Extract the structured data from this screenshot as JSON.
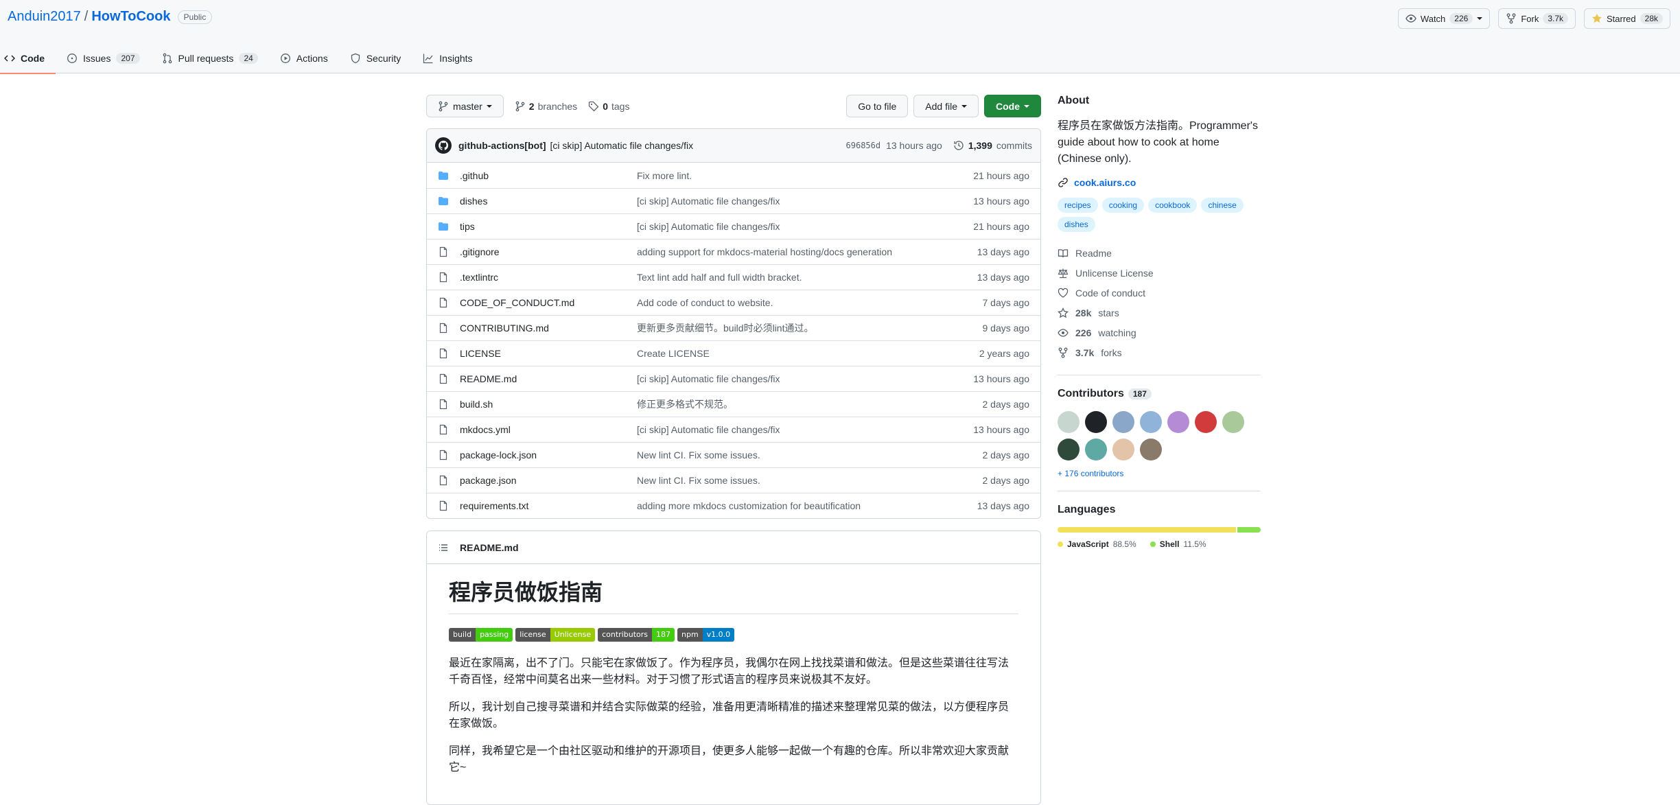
{
  "repo": {
    "owner": "Anduin2017",
    "separator": "/",
    "name": "HowToCook",
    "visibility": "Public"
  },
  "actions": {
    "watch_label": "Watch",
    "watch_count": "226",
    "fork_label": "Fork",
    "fork_count": "3.7k",
    "star_label": "Starred",
    "star_count": "28k"
  },
  "tabs": [
    {
      "label": "Code",
      "count": ""
    },
    {
      "label": "Issues",
      "count": "207"
    },
    {
      "label": "Pull requests",
      "count": "24"
    },
    {
      "label": "Actions",
      "count": ""
    },
    {
      "label": "Security",
      "count": ""
    },
    {
      "label": "Insights",
      "count": ""
    }
  ],
  "toolbar": {
    "branch": "master",
    "branches_count": "2",
    "branches_label": "branches",
    "tags_count": "0",
    "tags_label": "tags",
    "goto_file": "Go to file",
    "add_file": "Add file",
    "code": "Code"
  },
  "latest_commit": {
    "author": "github-actions[bot]",
    "message": "[ci skip] Automatic file changes/fix",
    "sha": "696856d",
    "age": "13 hours ago",
    "commit_count": "1,399",
    "commit_label": "commits"
  },
  "files": [
    {
      "name": ".github",
      "type": "dir",
      "message": "Fix more lint.",
      "age": "21 hours ago"
    },
    {
      "name": "dishes",
      "type": "dir",
      "message": "[ci skip] Automatic file changes/fix",
      "age": "13 hours ago"
    },
    {
      "name": "tips",
      "type": "dir",
      "message": "[ci skip] Automatic file changes/fix",
      "age": "21 hours ago"
    },
    {
      "name": ".gitignore",
      "type": "file",
      "message": "adding support for mkdocs-material hosting/docs generation",
      "age": "13 days ago"
    },
    {
      "name": ".textlintrc",
      "type": "file",
      "message": "Text lint add half and full width bracket.",
      "age": "13 days ago"
    },
    {
      "name": "CODE_OF_CONDUCT.md",
      "type": "file",
      "message": "Add code of conduct to website.",
      "age": "7 days ago"
    },
    {
      "name": "CONTRIBUTING.md",
      "type": "file",
      "message": "更新更多贡献细节。build时必须lint通过。",
      "age": "9 days ago"
    },
    {
      "name": "LICENSE",
      "type": "file",
      "message": "Create LICENSE",
      "age": "2 years ago"
    },
    {
      "name": "README.md",
      "type": "file",
      "message": "[ci skip] Automatic file changes/fix",
      "age": "13 hours ago"
    },
    {
      "name": "build.sh",
      "type": "file",
      "message": "修正更多格式不规范。",
      "age": "2 days ago"
    },
    {
      "name": "mkdocs.yml",
      "type": "file",
      "message": "[ci skip] Automatic file changes/fix",
      "age": "13 hours ago"
    },
    {
      "name": "package-lock.json",
      "type": "file",
      "message": "New lint CI. Fix some issues.",
      "age": "2 days ago"
    },
    {
      "name": "package.json",
      "type": "file",
      "message": "New lint CI. Fix some issues.",
      "age": "2 days ago"
    },
    {
      "name": "requirements.txt",
      "type": "file",
      "message": "adding more mkdocs customization for beautification",
      "age": "13 days ago"
    }
  ],
  "readme": {
    "filename": "README.md",
    "title": "程序员做饭指南",
    "badges": [
      {
        "left": "build",
        "right": "passing",
        "color": "#44cc11"
      },
      {
        "left": "license",
        "right": "Unlicense",
        "color": "#97ca00"
      },
      {
        "left": "contributors",
        "right": "187",
        "color": "#4c1"
      },
      {
        "left": "npm",
        "right": "v1.0.0",
        "color": "#007ec6"
      }
    ],
    "paragraphs": [
      "最近在家隔离，出不了门。只能宅在家做饭了。作为程序员，我偶尔在网上找找菜谱和做法。但是这些菜谱往往写法千奇百怪，经常中间莫名出来一些材料。对于习惯了形式语言的程序员来说极其不友好。",
      "所以，我计划自己搜寻菜谱和并结合实际做菜的经验，准备用更清晰精准的描述来整理常见菜的做法，以方便程序员在家做饭。",
      "同样，我希望它是一个由社区驱动和维护的开源项目，使更多人能够一起做一个有趣的仓库。所以非常欢迎大家贡献它~"
    ]
  },
  "about": {
    "heading": "About",
    "description": "程序员在家做饭方法指南。Programmer's guide about how to cook at home (Chinese only).",
    "homepage": "cook.aiurs.co",
    "topics": [
      "recipes",
      "cooking",
      "cookbook",
      "chinese",
      "dishes"
    ],
    "readme_label": "Readme",
    "license_label": "Unlicense License",
    "conduct_label": "Code of conduct",
    "stars_count": "28k",
    "stars_label": "stars",
    "watching_count": "226",
    "watching_label": "watching",
    "forks_count": "3.7k",
    "forks_label": "forks"
  },
  "contributors": {
    "heading": "Contributors",
    "count": "187",
    "avatar_colors": [
      "#c8d6d0",
      "#1f2328",
      "#8aa7c9",
      "#8fb3d9",
      "#b58bd6",
      "#d23b3b",
      "#a9c99a",
      "#2f4a3a",
      "#5ea9a3",
      "#e3c4a8",
      "#8a7a6a"
    ],
    "more_label": "+ 176 contributors"
  },
  "languages": {
    "heading": "Languages",
    "items": [
      {
        "name": "JavaScript",
        "percent": "88.5%",
        "value": 88.5,
        "color": "#f1e05a"
      },
      {
        "name": "Shell",
        "percent": "11.5%",
        "value": 11.5,
        "color": "#89e051"
      }
    ]
  }
}
